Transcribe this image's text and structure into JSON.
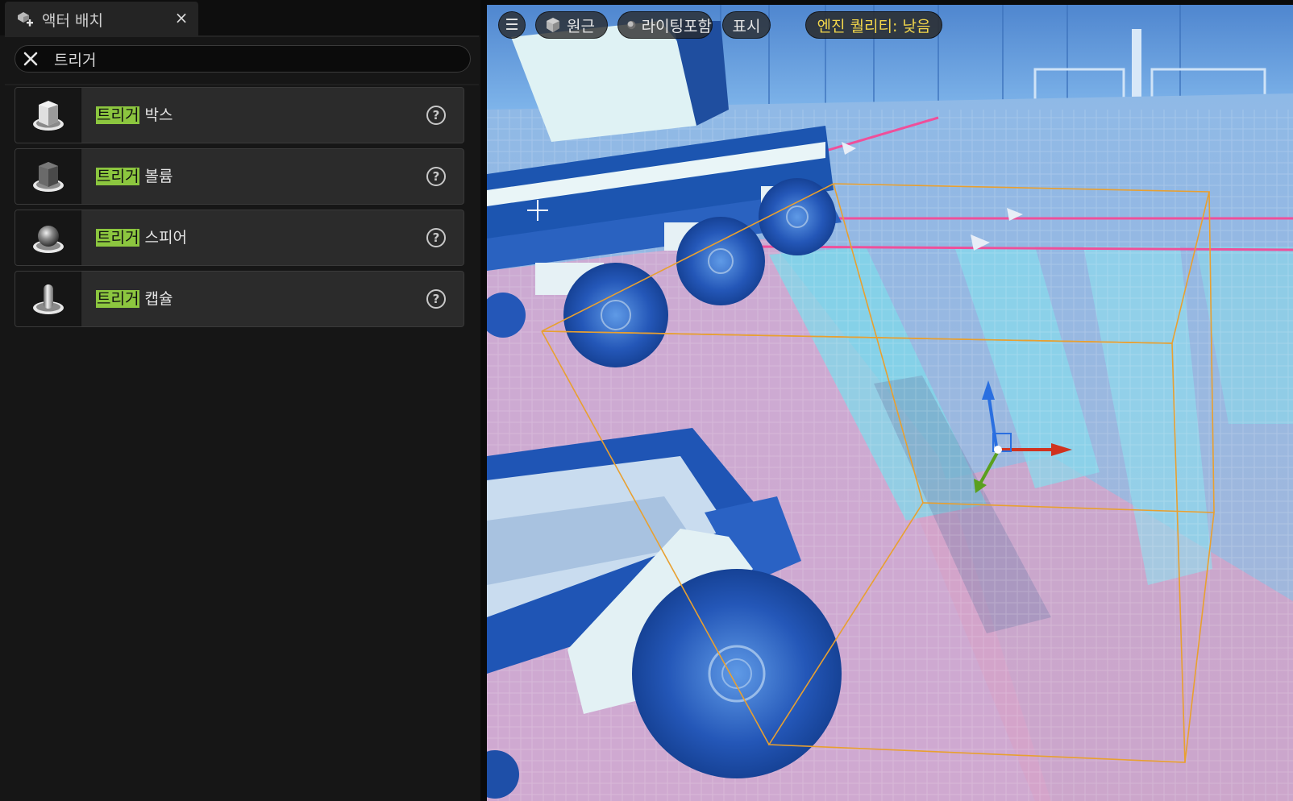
{
  "panel": {
    "tab_title": "액터 배치",
    "tab_close": "×",
    "search_value": "트리거",
    "items": [
      {
        "highlight": "트리거",
        "rest": " 박스",
        "icon": "trigger-box-icon"
      },
      {
        "highlight": "트리거",
        "rest": " 볼륨",
        "icon": "trigger-volume-icon"
      },
      {
        "highlight": "트리거",
        "rest": " 스피어",
        "icon": "trigger-sphere-icon"
      },
      {
        "highlight": "트리거",
        "rest": " 캡슐",
        "icon": "trigger-capsule-icon"
      }
    ],
    "help_glyph": "?"
  },
  "viewport": {
    "menu_glyph": "☰",
    "perspective_label": "원근",
    "lighting_label": "라이팅포함",
    "show_label": "표시",
    "quality_label": "엔진 퀄리티: 낮음"
  },
  "colors": {
    "highlight": "#8cc63f",
    "quality_text": "#f2d64b",
    "selection_box": "#e8a030",
    "gizmo_x": "#d0321e",
    "gizmo_y": "#5aa01e",
    "gizmo_z": "#2a6fe0"
  }
}
